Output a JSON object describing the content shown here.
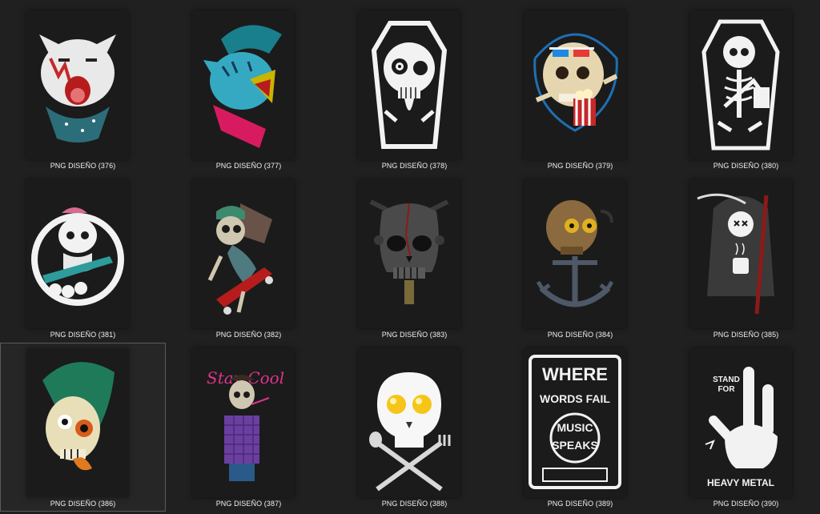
{
  "colors": {
    "background": "#202020",
    "thumb": "#1b1b1b",
    "text": "#f0f0f0",
    "selection": "#5c5c5c"
  },
  "files": [
    {
      "name": "PNG DISEÑO (376)",
      "icon": "cat-bandana-icon",
      "selected": false
    },
    {
      "name": "PNG DISEÑO (377)",
      "icon": "blue-cat-mohawk-icon",
      "selected": false
    },
    {
      "name": "PNG DISEÑO (378)",
      "icon": "skull-coffin-icon",
      "selected": false
    },
    {
      "name": "PNG DISEÑO (379)",
      "icon": "skull-3d-glasses-icon",
      "selected": false
    },
    {
      "name": "PNG DISEÑO (380)",
      "icon": "skeleton-coffin-icon",
      "selected": false
    },
    {
      "name": "PNG DISEÑO (381)",
      "icon": "skateboard-skull-icon",
      "selected": false
    },
    {
      "name": "PNG DISEÑO (382)",
      "icon": "zombie-skater-icon",
      "selected": false
    },
    {
      "name": "PNG DISEÑO (383)",
      "icon": "grey-skull-helmet-icon",
      "selected": false
    },
    {
      "name": "PNG DISEÑO (384)",
      "icon": "skull-anchor-icon",
      "selected": false
    },
    {
      "name": "PNG DISEÑO (385)",
      "icon": "reaper-coffee-icon",
      "selected": false
    },
    {
      "name": "PNG DISEÑO (386)",
      "icon": "mohawk-skull-icon",
      "selected": true
    },
    {
      "name": "PNG DISEÑO (387)",
      "icon": "stay-cool-skeleton-icon",
      "selected": false
    },
    {
      "name": "PNG DISEÑO (388)",
      "icon": "egg-skull-utensils-icon",
      "selected": false
    },
    {
      "name": "PNG DISEÑO (389)",
      "icon": "cassette-music-icon",
      "selected": false
    },
    {
      "name": "PNG DISEÑO (390)",
      "icon": "heavy-metal-hand-icon",
      "selected": false
    }
  ],
  "art_text": {
    "a387": "Stay Cool",
    "a389": [
      "WHERE",
      "WORDS FAIL",
      "MUSIC",
      "SPEAKS"
    ],
    "a390": [
      "STAND",
      "FOR",
      "HEAVY METAL"
    ]
  }
}
